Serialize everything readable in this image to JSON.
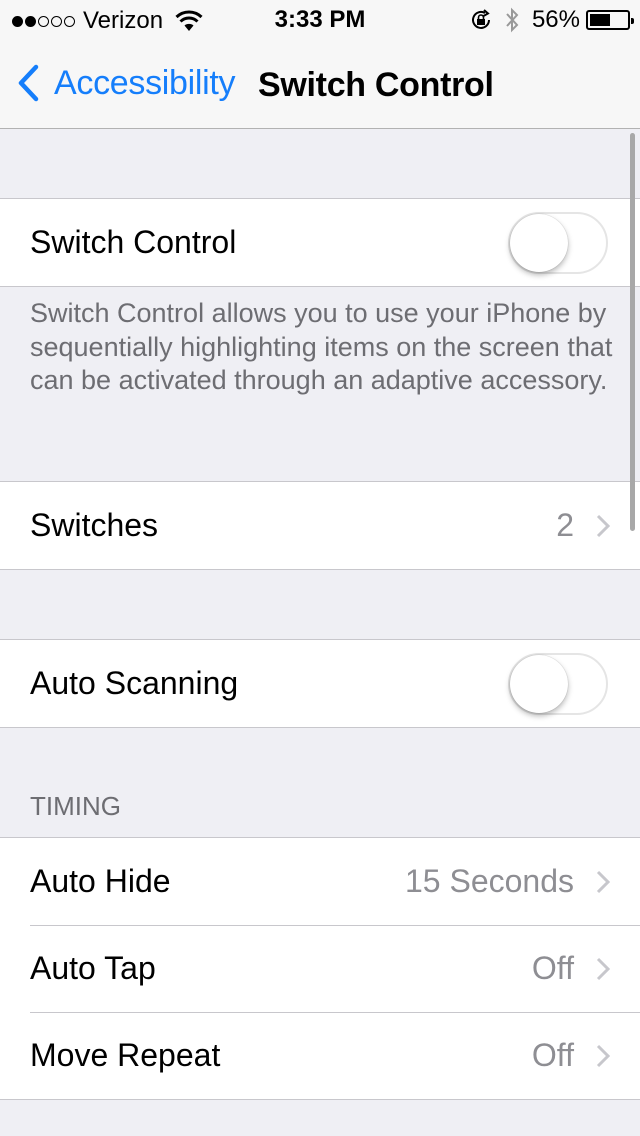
{
  "status_bar": {
    "signal_bars_filled": 2,
    "signal_bars_total": 5,
    "carrier": "Verizon",
    "wifi_icon": "wifi-icon",
    "time": "3:33 PM",
    "orientation_lock_icon": "orientation-lock-icon",
    "bluetooth_icon": "bluetooth-icon",
    "battery_percent_label": "56%",
    "battery_level": 0.56
  },
  "nav": {
    "back_label": "Accessibility",
    "title": "Switch Control"
  },
  "colors": {
    "accent": "#157efb",
    "background": "#efeff4",
    "secondary_text": "#8e8e93",
    "footer_text": "#6d6d72"
  },
  "groups": {
    "switch_control": {
      "label": "Switch Control",
      "toggle_on": false
    },
    "description": "Switch Control allows you to use your iPhone by sequentially highlighting items on the screen that can be activated through an adaptive accessory.",
    "switches": {
      "label": "Switches",
      "value": "2"
    },
    "auto_scanning": {
      "label": "Auto Scanning",
      "toggle_on": false
    },
    "timing": {
      "header": "TIMING",
      "items": [
        {
          "label": "Auto Hide",
          "value": "15 Seconds"
        },
        {
          "label": "Auto Tap",
          "value": "Off"
        },
        {
          "label": "Move Repeat",
          "value": "Off"
        }
      ]
    }
  }
}
